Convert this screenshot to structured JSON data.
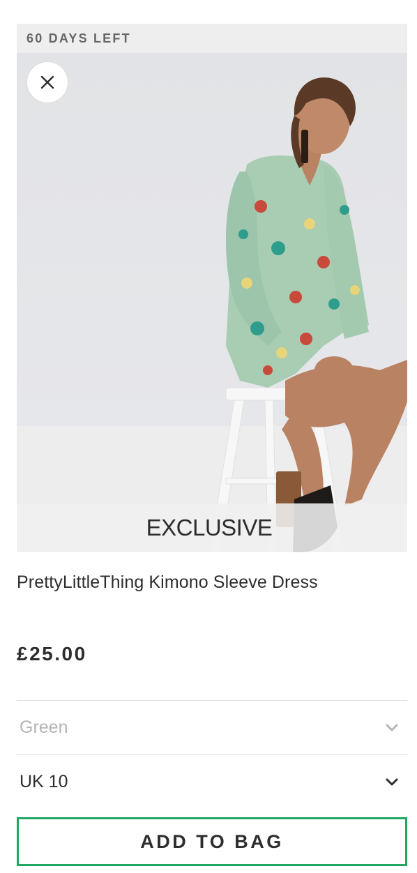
{
  "product": {
    "days_left": "60 DAYS LEFT",
    "badge": "EXCLUSIVE",
    "title": "PrettyLittleThing Kimono Sleeve Dress",
    "price": "£25.00",
    "colour": "Green",
    "size": "UK 10",
    "add_to_bag": "ADD TO BAG"
  },
  "icons": {
    "close": "close-icon",
    "chevron": "chevron-down-icon"
  },
  "colors": {
    "accent_border": "#20a861",
    "days_left_bg": "#eeeeee",
    "text": "#2d2d2d",
    "muted": "#b4b4b4"
  }
}
